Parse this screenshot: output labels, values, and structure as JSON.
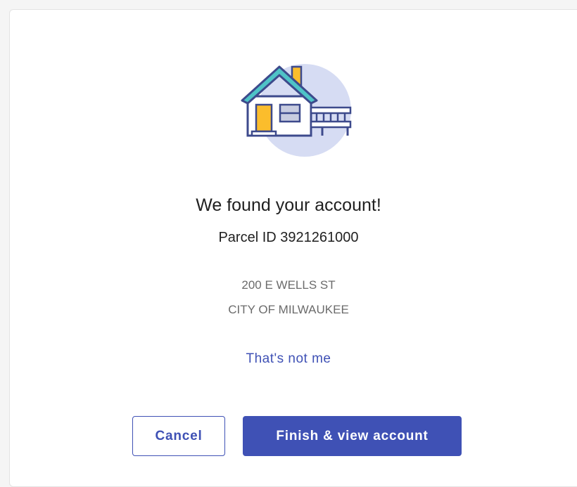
{
  "dialog": {
    "title": "We found your account!",
    "parcel_label": "Parcel ID 3921261000",
    "address_line1": "200 E WELLS ST",
    "address_line2": "CITY OF MILWAUKEE",
    "not_me_link": "That's not me"
  },
  "buttons": {
    "cancel_label": "Cancel",
    "finish_label": "Finish & view account"
  },
  "illustration": {
    "icon": "house-icon"
  },
  "colors": {
    "accent": "#3f51b5",
    "circle": "#d6dcf3",
    "roof": "#4fc3c7",
    "door": "#fbbd2c",
    "outline": "#3d4a8c"
  }
}
